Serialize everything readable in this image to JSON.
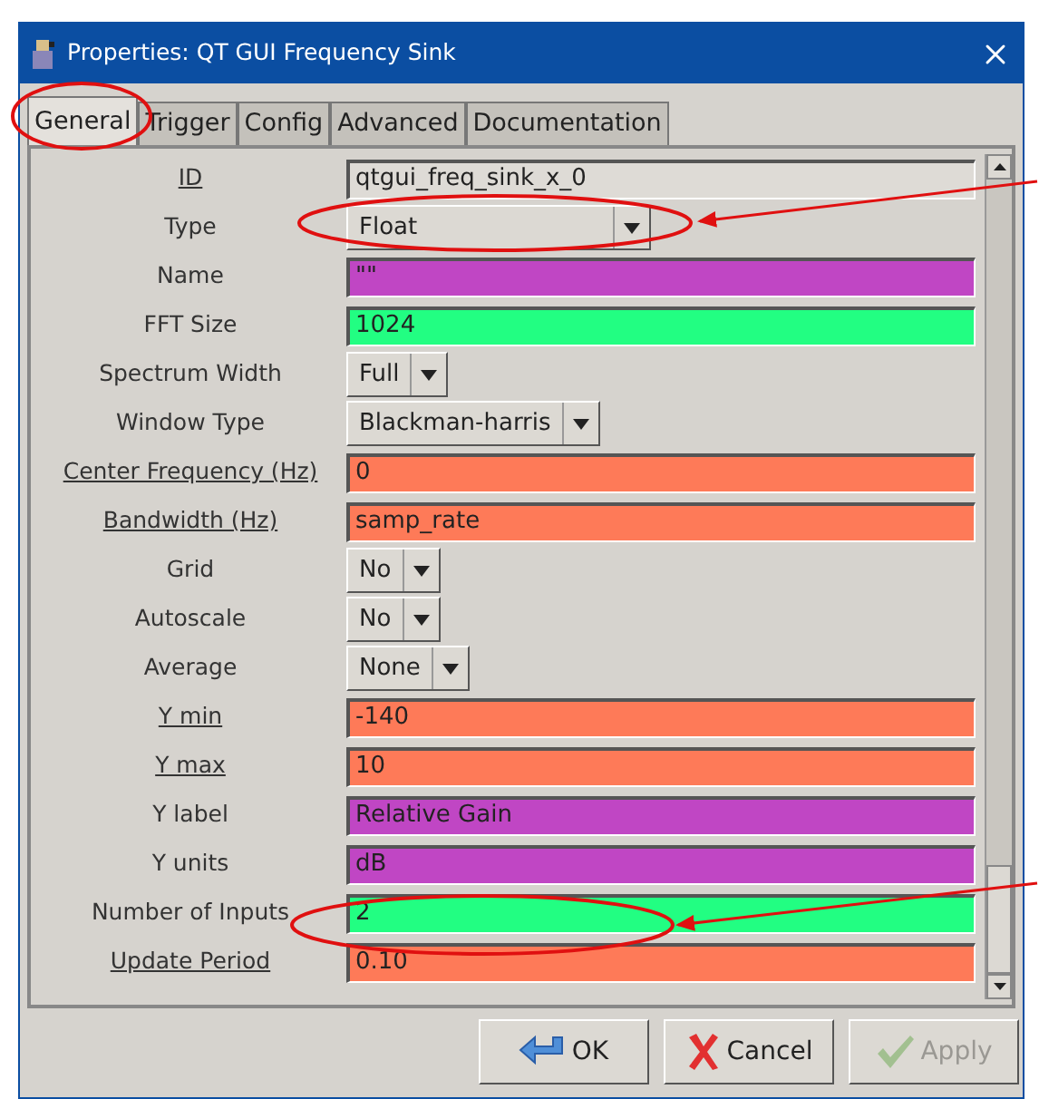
{
  "window": {
    "title": "Properties: QT GUI Frequency Sink"
  },
  "tabs": [
    {
      "label": "General",
      "selected": true
    },
    {
      "label": "Trigger",
      "selected": false
    },
    {
      "label": "Config",
      "selected": false
    },
    {
      "label": "Advanced",
      "selected": false
    },
    {
      "label": "Documentation",
      "selected": false
    }
  ],
  "params": [
    {
      "label": "ID",
      "underlined": true,
      "kind": "text",
      "value": "qtgui_freq_sink_x_0",
      "color": "#dedbd6"
    },
    {
      "label": "Type",
      "underlined": false,
      "kind": "dropdown",
      "value": "Float"
    },
    {
      "label": "Name",
      "underlined": false,
      "kind": "text",
      "value": "\"\"",
      "color": "#c046c4"
    },
    {
      "label": "FFT Size",
      "underlined": false,
      "kind": "text",
      "value": "1024",
      "color": "#22fe82"
    },
    {
      "label": "Spectrum Width",
      "underlined": false,
      "kind": "dropdown",
      "value": "Full"
    },
    {
      "label": "Window Type",
      "underlined": false,
      "kind": "dropdown",
      "value": "Blackman-harris"
    },
    {
      "label": "Center Frequency (Hz)",
      "underlined": true,
      "kind": "text",
      "value": "0",
      "color": "#fe7a58"
    },
    {
      "label": "Bandwidth (Hz)",
      "underlined": true,
      "kind": "text",
      "value": "samp_rate",
      "color": "#fe7a58"
    },
    {
      "label": "Grid",
      "underlined": false,
      "kind": "dropdown",
      "value": "No"
    },
    {
      "label": "Autoscale",
      "underlined": false,
      "kind": "dropdown",
      "value": "No"
    },
    {
      "label": "Average",
      "underlined": false,
      "kind": "dropdown",
      "value": "None"
    },
    {
      "label": "Y min",
      "underlined": true,
      "kind": "text",
      "value": "-140",
      "color": "#fe7a58"
    },
    {
      "label": "Y max",
      "underlined": true,
      "kind": "text",
      "value": "10",
      "color": "#fe7a58"
    },
    {
      "label": "Y label",
      "underlined": false,
      "kind": "text",
      "value": "Relative Gain",
      "color": "#c046c4"
    },
    {
      "label": "Y units",
      "underlined": false,
      "kind": "text",
      "value": "dB",
      "color": "#c046c4"
    },
    {
      "label": "Number of Inputs",
      "underlined": false,
      "kind": "text",
      "value": "2",
      "color": "#22fe82"
    },
    {
      "label": "Update Period",
      "underlined": true,
      "kind": "text",
      "value": "0.10",
      "color": "#fe7a58"
    }
  ],
  "buttons": [
    {
      "kind": "ok",
      "label": "OK",
      "disabled": false
    },
    {
      "kind": "cancel",
      "label": "Cancel",
      "disabled": false
    },
    {
      "kind": "apply",
      "label": "Apply",
      "disabled": true
    }
  ]
}
